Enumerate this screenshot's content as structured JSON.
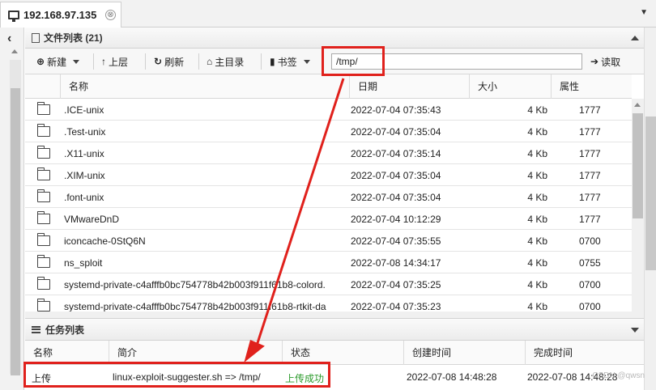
{
  "tab": {
    "title": "192.168.97.135",
    "close_glyph": "⊗"
  },
  "file_panel": {
    "title": "文件列表 (21)",
    "toolbar": {
      "new_label": "新建",
      "up_label": "上层",
      "refresh_label": "刷新",
      "home_label": "主目录",
      "bookmark_label": "书签",
      "path_value": "/tmp/",
      "read_label": "读取"
    },
    "columns": {
      "name": "名称",
      "date": "日期",
      "size": "大小",
      "attr": "属性"
    },
    "files": [
      {
        "name": ".ICE-unix",
        "date": "2022-07-04 07:35:43",
        "size": "4 Kb",
        "attr": "1777"
      },
      {
        "name": ".Test-unix",
        "date": "2022-07-04 07:35:04",
        "size": "4 Kb",
        "attr": "1777"
      },
      {
        "name": ".X11-unix",
        "date": "2022-07-04 07:35:14",
        "size": "4 Kb",
        "attr": "1777"
      },
      {
        "name": ".XIM-unix",
        "date": "2022-07-04 07:35:04",
        "size": "4 Kb",
        "attr": "1777"
      },
      {
        "name": ".font-unix",
        "date": "2022-07-04 07:35:04",
        "size": "4 Kb",
        "attr": "1777"
      },
      {
        "name": "VMwareDnD",
        "date": "2022-07-04 10:12:29",
        "size": "4 Kb",
        "attr": "1777"
      },
      {
        "name": "iconcache-0StQ6N",
        "date": "2022-07-04 07:35:55",
        "size": "4 Kb",
        "attr": "0700"
      },
      {
        "name": "ns_sploit",
        "date": "2022-07-08 14:34:17",
        "size": "4 Kb",
        "attr": "0755"
      },
      {
        "name": "systemd-private-c4afffb0bc754778b42b003f911f61b8-colord.",
        "date": "2022-07-04 07:35:25",
        "size": "4 Kb",
        "attr": "0700"
      },
      {
        "name": "systemd-private-c4afffb0bc754778b42b003f911f61b8-rtkit-da",
        "date": "2022-07-04 07:35:23",
        "size": "4 Kb",
        "attr": "0700"
      }
    ]
  },
  "task_panel": {
    "title": "任务列表",
    "columns": {
      "name": "名称",
      "desc": "简介",
      "status": "状态",
      "created": "创建时间",
      "finished": "完成时间"
    },
    "task": {
      "name": "上传",
      "desc": "linux-exploit-suggester.sh => /tmp/",
      "status": "上传成功",
      "created": "2022-07-08 14:48:28",
      "finished": "2022-07-08 14:48:28"
    }
  },
  "watermark": "CSDN @qwsn",
  "colors": {
    "annotation": "#e0211c",
    "success": "#2a9a2a"
  }
}
